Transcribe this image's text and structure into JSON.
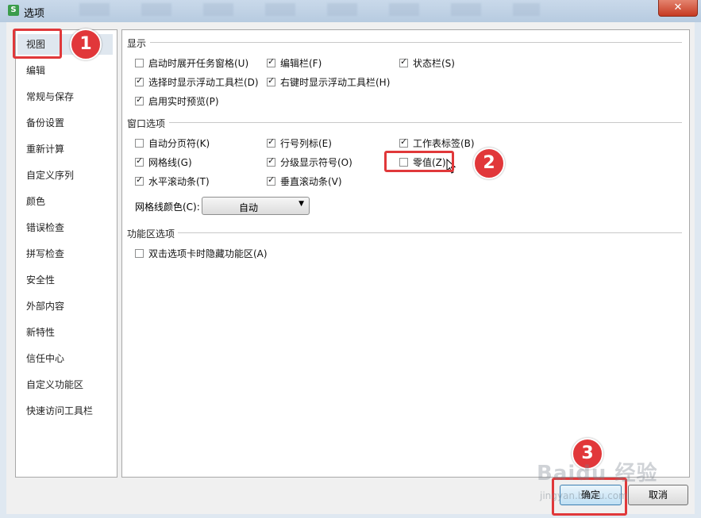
{
  "window": {
    "title": "选项",
    "close_label": "✕"
  },
  "sidebar": {
    "items": [
      {
        "label": "视图"
      },
      {
        "label": "编辑"
      },
      {
        "label": "常规与保存"
      },
      {
        "label": "备份设置"
      },
      {
        "label": "重新计算"
      },
      {
        "label": "自定义序列"
      },
      {
        "label": "颜色"
      },
      {
        "label": "错误检查"
      },
      {
        "label": "拼写检查"
      },
      {
        "label": "安全性"
      },
      {
        "label": "外部内容"
      },
      {
        "label": "新特性"
      },
      {
        "label": "信任中心"
      },
      {
        "label": "自定义功能区"
      },
      {
        "label": "快速访问工具栏"
      }
    ],
    "selected": "视图"
  },
  "sections": {
    "display": {
      "title": "显示",
      "options": [
        {
          "label": "启动时展开任务窗格(U)",
          "checked": false
        },
        {
          "label": "编辑栏(F)",
          "checked": true
        },
        {
          "label": "状态栏(S)",
          "checked": true
        },
        {
          "label": "选择时显示浮动工具栏(D)",
          "checked": true
        },
        {
          "label": "右键时显示浮动工具栏(H)",
          "checked": true
        },
        {
          "label": "启用实时预览(P)",
          "checked": true
        }
      ]
    },
    "window_options": {
      "title": "窗口选项",
      "options": [
        {
          "label": "自动分页符(K)",
          "checked": false
        },
        {
          "label": "行号列标(E)",
          "checked": true
        },
        {
          "label": "工作表标签(B)",
          "checked": true
        },
        {
          "label": "网格线(G)",
          "checked": true
        },
        {
          "label": "分级显示符号(O)",
          "checked": true
        },
        {
          "label": "零值(Z)",
          "checked": false
        },
        {
          "label": "水平滚动条(T)",
          "checked": true
        },
        {
          "label": "垂直滚动条(V)",
          "checked": true
        }
      ],
      "gridline_color_label": "网格线颜色(C):",
      "gridline_color_value": "自动"
    },
    "ribbon": {
      "title": "功能区选项",
      "options": [
        {
          "label": "双击选项卡时隐藏功能区(A)",
          "checked": false
        }
      ]
    }
  },
  "buttons": {
    "ok": "确定",
    "cancel": "取消"
  },
  "annotations": {
    "step1": "1",
    "step2": "2",
    "step3": "3"
  },
  "watermark": {
    "text": "Baidu 经验",
    "url": "jingyan.baidu.com"
  }
}
